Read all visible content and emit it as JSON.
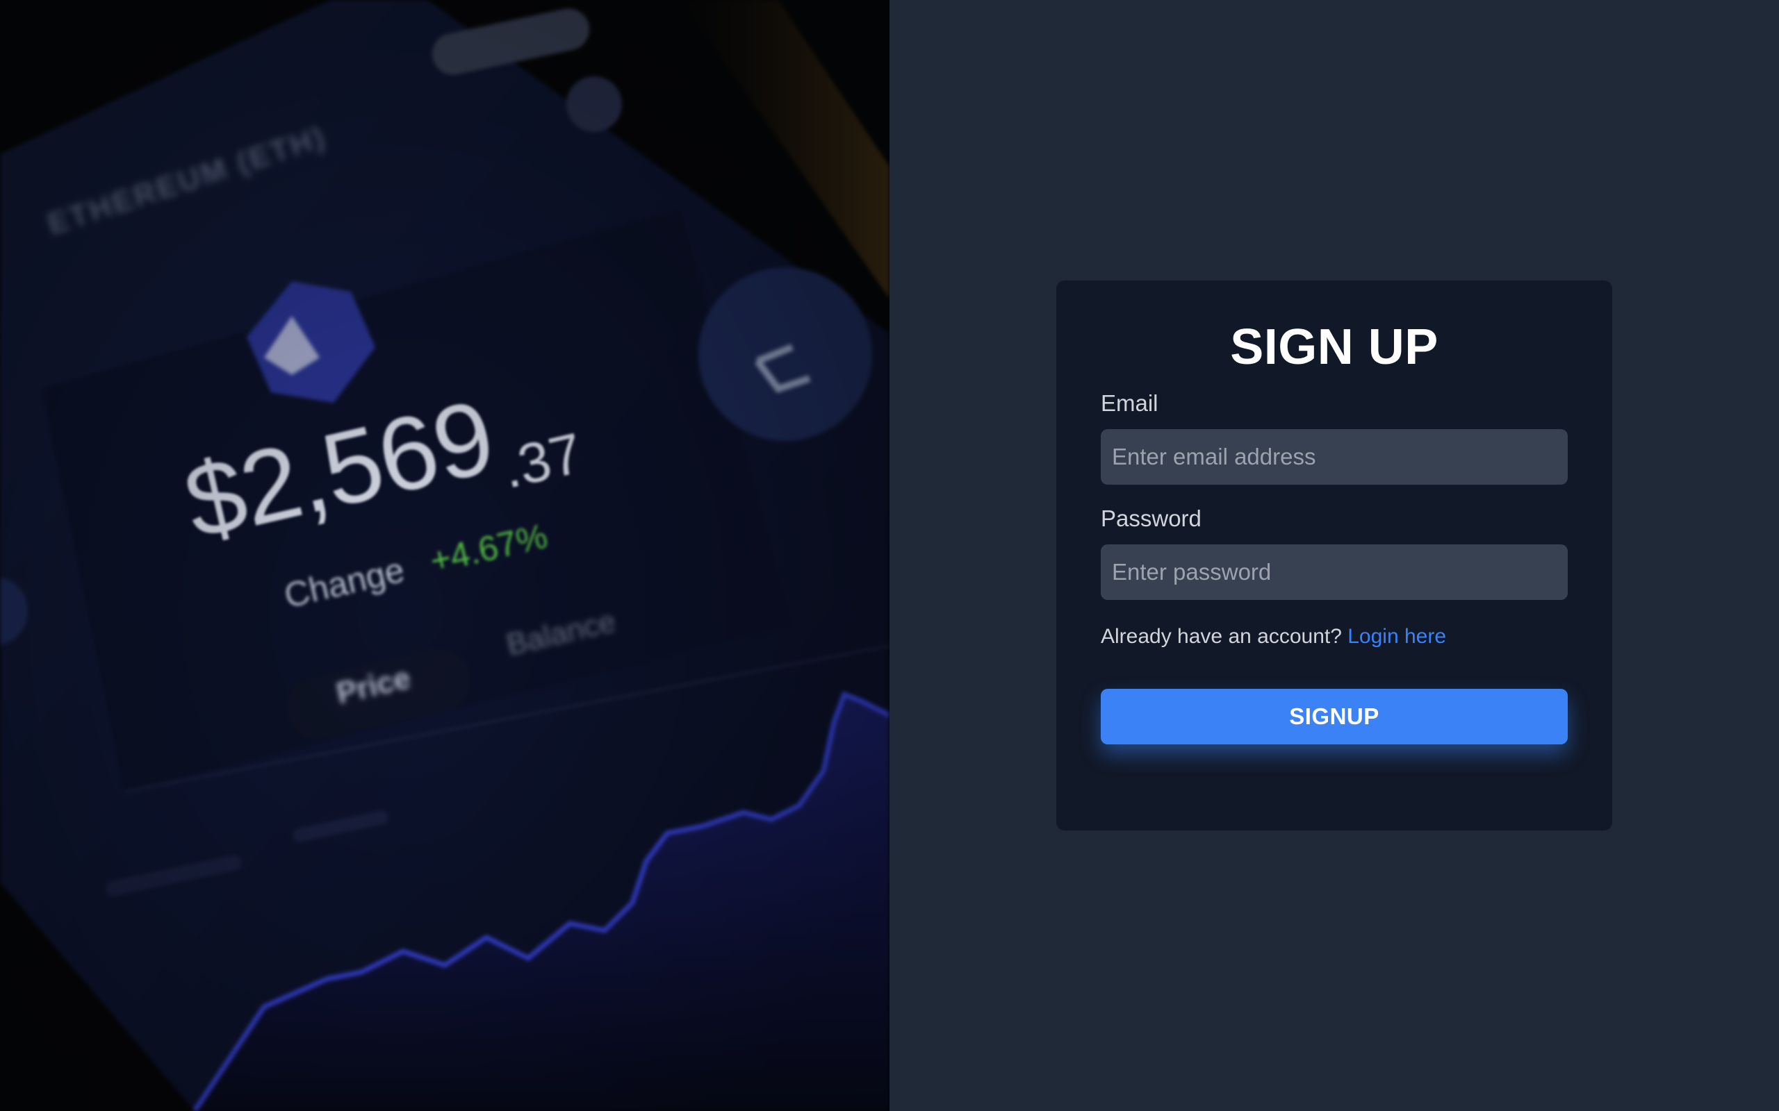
{
  "hero": {
    "coin_title": "ETHEREUM (ETH)",
    "price_main": "$2,569",
    "price_cents": ".37",
    "change_label": "Change",
    "change_value": "+4.67%",
    "tab_price": "Price",
    "tab_balance": "Balance",
    "change_color": "#58c247",
    "chart_color": "#3b46e6"
  },
  "form": {
    "title": "SIGN UP",
    "email": {
      "label": "Email",
      "placeholder": "Enter email address",
      "value": ""
    },
    "password": {
      "label": "Password",
      "placeholder": "Enter password",
      "value": ""
    },
    "login_prompt": "Already have an account?",
    "login_link": "Login here",
    "submit_label": "SIGNUP"
  },
  "colors": {
    "page_bg": "#1f2937",
    "card_bg": "#111827",
    "input_bg": "#374151",
    "accent": "#3b82f6"
  }
}
